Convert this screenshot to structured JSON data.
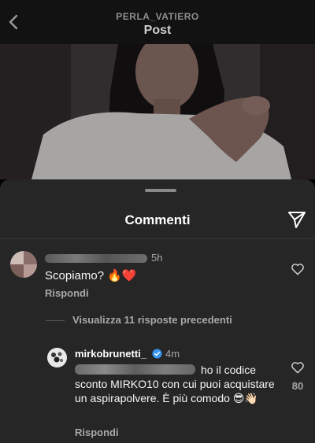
{
  "header": {
    "username": "PERLA_VATIERO",
    "title": "Post",
    "back_icon": "chevron-left-icon"
  },
  "sheet": {
    "title": "Commenti",
    "share_icon": "send-icon"
  },
  "comments": [
    {
      "time": "5h",
      "text": "Scopiamo? 🔥❤️",
      "reply_label": "Rispondi",
      "like_icon": "heart-outline-icon"
    }
  ],
  "view_replies": "Visualizza 11 risposte precedenti",
  "reply": {
    "username": "mirkobrunetti_",
    "verified_icon": "verified-badge-icon",
    "time": "4m",
    "text": "ho il codice sconto MIRKO10 con cui puoi acquistare un aspirapolvere. È più comodo 😎👋🏻",
    "likes": "80",
    "reply_label": "Rispondi",
    "like_icon": "heart-outline-icon"
  },
  "colors": {
    "sheet_bg": "#262626",
    "header_bg": "#121212",
    "secondary_text": "#a8a8a8",
    "verified_blue": "#3897f0"
  }
}
